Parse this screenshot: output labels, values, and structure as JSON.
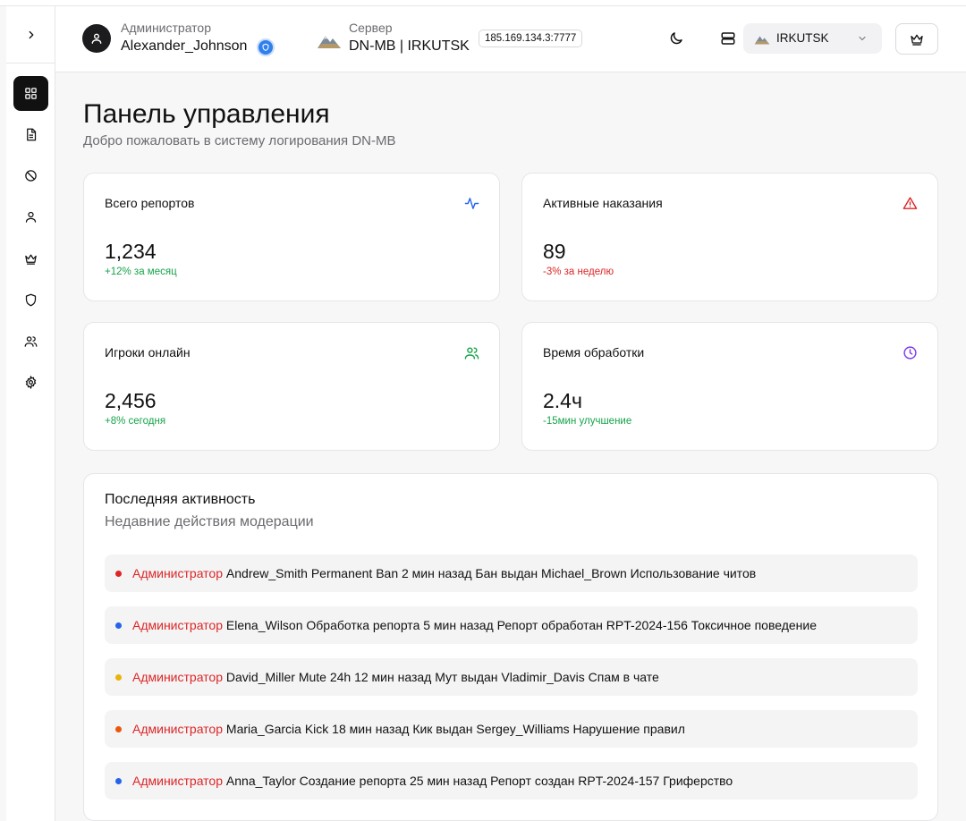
{
  "header": {
    "admin_role": "Администратор",
    "admin_name": "Alexander_Johnson",
    "server_label": "Сервер",
    "server_name": "DN-MB | IRKUTSK",
    "server_ip": "185.169.134.3:7777",
    "server_select_value": "IRKUTSK"
  },
  "sidebar": {
    "items": [
      {
        "name": "dashboard",
        "icon": "grid-icon",
        "active": true
      },
      {
        "name": "reports",
        "icon": "document-icon"
      },
      {
        "name": "punishments",
        "icon": "ban-icon"
      },
      {
        "name": "players",
        "icon": "user-icon"
      },
      {
        "name": "admins",
        "icon": "crown-icon"
      },
      {
        "name": "security",
        "icon": "shield-icon"
      },
      {
        "name": "team",
        "icon": "users-icon"
      },
      {
        "name": "settings",
        "icon": "gear-icon"
      }
    ]
  },
  "page": {
    "title": "Панель управления",
    "subtitle": "Добро пожаловать в систему логирования DN-MB"
  },
  "stats": [
    {
      "title": "Всего репортов",
      "value": "1,234",
      "delta": "+12% за месяц",
      "delta_color": "green",
      "icon": "activity-icon",
      "icon_color": "#2563eb"
    },
    {
      "title": "Активные наказания",
      "value": "89",
      "delta": "-3% за неделю",
      "delta_color": "red",
      "icon": "warning-icon",
      "icon_color": "#dc2626"
    },
    {
      "title": "Игроки онлайн",
      "value": "2,456",
      "delta": "+8% сегодня",
      "delta_color": "green",
      "icon": "users-icon",
      "icon_color": "#16a34a"
    },
    {
      "title": "Время обработки",
      "value": "2.4ч",
      "delta": "-15мин улучшение",
      "delta_color": "green",
      "icon": "clock-icon",
      "icon_color": "#7c3aed"
    }
  ],
  "activity": {
    "title": "Последняя активность",
    "subtitle": "Недавние действия модерации",
    "items": [
      {
        "role": "Администратор",
        "text": "Andrew_Smith Permanent Ban 2 мин назад Бан выдан Michael_Brown Использование читов",
        "dot_color": "#dc2626"
      },
      {
        "role": "Администратор",
        "text": "Elena_Wilson Обработка репорта 5 мин назад Репорт обработан RPT-2024-156 Токсичное поведение",
        "dot_color": "#2563eb"
      },
      {
        "role": "Администратор",
        "text": "David_Miller Mute 24h 12 мин назад Мут выдан Vladimir_Davis Спам в чате",
        "dot_color": "#eab308"
      },
      {
        "role": "Администратор",
        "text": "Maria_Garcia Kick 18 мин назад Кик выдан Sergey_Williams Нарушение правил",
        "dot_color": "#ea580c"
      },
      {
        "role": "Администратор",
        "text": "Anna_Taylor Создание репорта 25 мин назад Репорт создан RPT-2024-157 Гриферство",
        "dot_color": "#2563eb"
      }
    ]
  }
}
